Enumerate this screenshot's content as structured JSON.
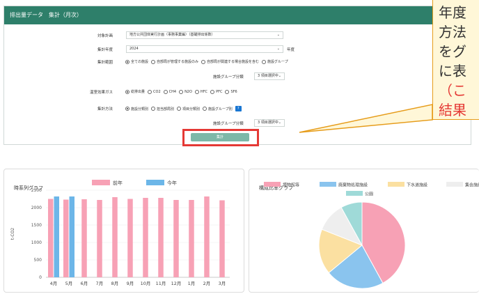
{
  "form": {
    "title": "排出量データ　集計（月次）",
    "plan_label": "対象計画",
    "plan_value": "地方公共団体実行計画（事務事業編）（基礎排出係数）",
    "year_label": "集計年度",
    "year_value": "2024",
    "year_suffix": "年度",
    "scope_label": "集計範囲",
    "scope_options": [
      "全ての施設",
      "自部局が管理する施設のみ",
      "自部局が関連する場合施設を含む",
      "施設グループ"
    ],
    "group_class_label": "施設グループ分類",
    "group_class_value": "3 項目選択中",
    "gas_label": "温室効果ガス",
    "gas_options": [
      "総排出量",
      "CO2",
      "CH4",
      "N2O",
      "HFC",
      "PFC",
      "SF6"
    ],
    "method_label": "集計方法",
    "method_options": [
      "施設分類別",
      "担当部局別",
      "項目分類別",
      "施設グループ別"
    ],
    "help_text": "?",
    "group_class_value2": "3 項目選択中",
    "submit_label": "集計"
  },
  "callout": {
    "lines": [
      "年度",
      "方法",
      "をグ",
      "に表",
      "（こ",
      "結果"
    ],
    "colors": [
      "#1a1a1a",
      "#1a1a1a",
      "#1a1a1a",
      "#1a1a1a",
      "#e53935",
      "#e53935"
    ]
  },
  "timeseries": {
    "title": "時系列グラフ",
    "chart_data": {
      "type": "bar",
      "categories": [
        "4月",
        "5月",
        "6月",
        "7月",
        "8月",
        "9月",
        "10月",
        "11月",
        "12月",
        "1月",
        "2月",
        "3月"
      ],
      "series": [
        {
          "name": "前年",
          "color": "#f7a1b5",
          "values": [
            2250,
            2230,
            2240,
            2220,
            2300,
            2250,
            2280,
            2280,
            2220,
            2220,
            2320,
            2210
          ]
        },
        {
          "name": "今年",
          "color": "#6cb6e8",
          "values": [
            2320,
            2320,
            null,
            null,
            null,
            null,
            null,
            null,
            null,
            null,
            null,
            null
          ]
        }
      ],
      "ylabel": "t-CO2",
      "ylim": [
        0,
        2500
      ],
      "yticks": [
        0,
        500,
        1000,
        1500,
        2000,
        2500
      ]
    }
  },
  "composition": {
    "title": "構成比率グラフ",
    "chart_data": {
      "type": "pie",
      "labels": [
        "博物館等",
        "廃棄物処理施設",
        "下水道施設",
        "集会施設",
        "公園"
      ],
      "colors": [
        "#f7a1b5",
        "#8ac4ee",
        "#fbe0a1",
        "#eeeeee",
        "#9fdad8"
      ],
      "values": [
        42,
        22,
        17,
        11,
        8
      ]
    }
  }
}
